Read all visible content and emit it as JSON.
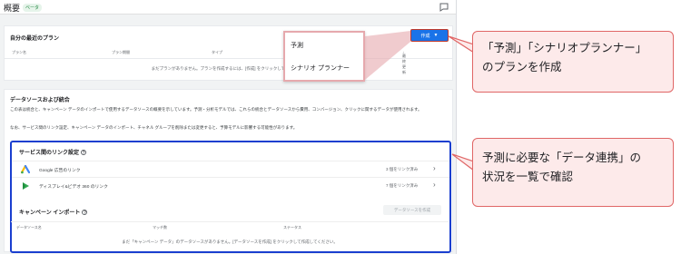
{
  "header": {
    "title": "概要",
    "badge": "ベータ"
  },
  "plans": {
    "title": "自分の最近のプラン",
    "create_button": "作成",
    "columns": [
      "プラン名",
      "プラン期間",
      "タイプ",
      "予算の",
      "最終更新"
    ],
    "empty_message": "まだプランがありません。プランを作成するには、[作成] をクリックしてください。"
  },
  "dropdown": {
    "options": [
      "予測",
      "シナリオ プランナー"
    ]
  },
  "data_sources": {
    "title": "データソースおよび統合",
    "description": "この表は統合と、キャンペーン データのインポートで使用するデータソースの概要を示しています。予測・分析モデルでは、これらの統合とデータソースから費用、コンバージョン、クリックに関するデータが使用されます。",
    "note": "なお、サービス間のリンク設定、キャンペーン データのインポート、チャネル グループを削除または変更すると、予算モデルに影響する可能性があります。",
    "service_links": {
      "title": "サービス間のリンク設定",
      "help": "?",
      "rows": [
        {
          "name": "Google 広告のリンク",
          "status": "3 個をリンク済み"
        },
        {
          "name": "ディスプレイ&ビデオ 360 のリンク",
          "status": "7 個をリンク済み"
        }
      ]
    },
    "campaign_import": {
      "title": "キャンペーン インポート",
      "help": "?",
      "create_button": "データソースを作成",
      "columns": [
        "データソース名",
        "マッチ数",
        "ステータス"
      ],
      "empty_message": "まだ「キャンペーン データ」のデータソースがありません。[データソースを作成] をクリックして作成してください。"
    }
  },
  "callouts": {
    "plan": [
      "「予測」「シナリオプランナー」",
      "のプランを作成"
    ],
    "data": [
      "予測に必要な「データ連携」の",
      "状況を一覧で確認"
    ]
  },
  "colors": {
    "accent": "#1a73e8",
    "callout_border": "#e06666",
    "callout_fill": "#fdeaea",
    "highlight_box": "#1a3fcf"
  }
}
